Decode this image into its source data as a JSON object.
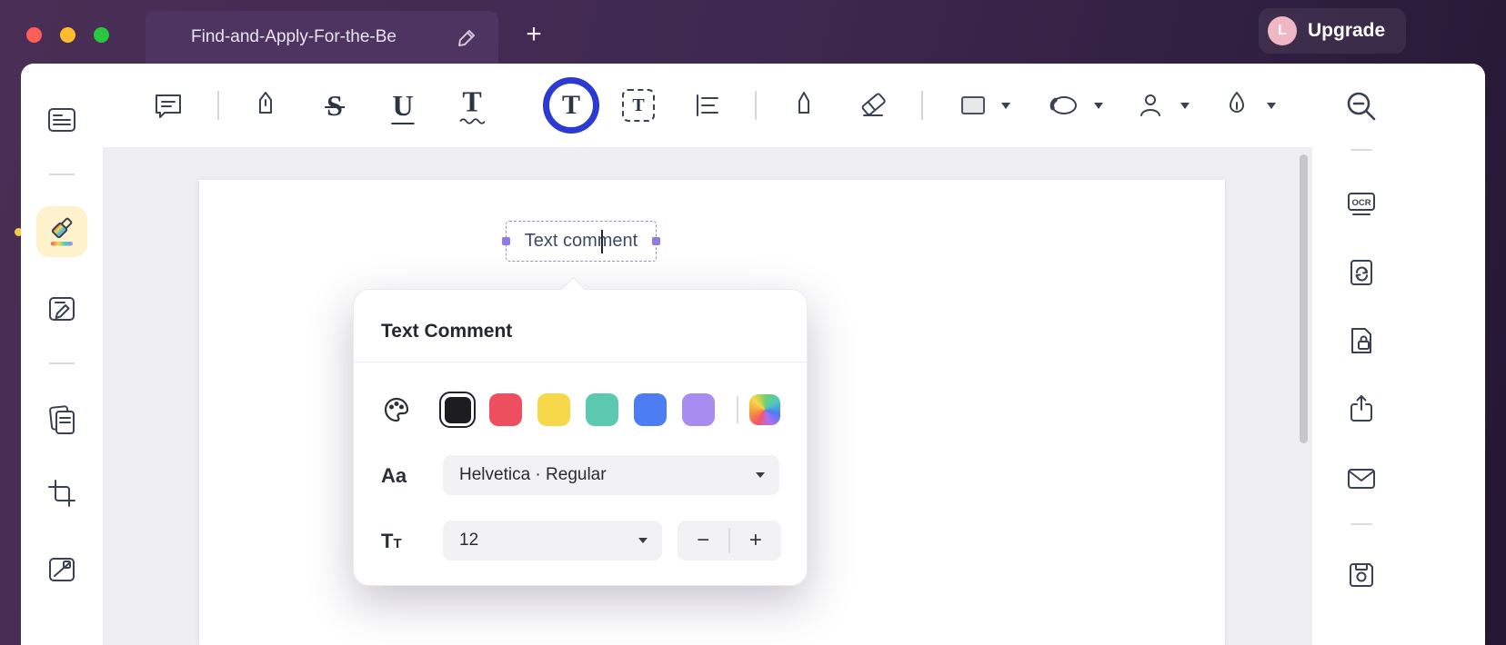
{
  "titlebar": {
    "tab_title": "Find-and-Apply-For-the-Be",
    "new_tab_label": "+",
    "avatar_letter": "L",
    "upgrade_label": "Upgrade",
    "colors": {
      "close": "#ff5f57",
      "minimize": "#febc2e",
      "zoom": "#28c840",
      "avatar_bg": "#efb6c3"
    }
  },
  "toolbar": {
    "strikethrough_glyph": "S",
    "underline_glyph": "U",
    "squiggly_glyph": "T",
    "text_tool_glyph": "T",
    "text_box_glyph": "T",
    "accent_ring": "#2b3bd1"
  },
  "right_rail": {
    "ocr_label": "OCR"
  },
  "document": {
    "text_comment_value": "Text comment"
  },
  "popup": {
    "title": "Text Comment",
    "font_row_label": "Aa",
    "size_row_label": "Tt",
    "font_value": "Helvetica · Regular",
    "size_value": "12",
    "decrease_label": "−",
    "increase_label": "+",
    "swatches": [
      "#1d1d20",
      "#ee4f5e",
      "#f8d84b",
      "#5bc8af",
      "#4d7df2",
      "#a88cf0"
    ]
  }
}
